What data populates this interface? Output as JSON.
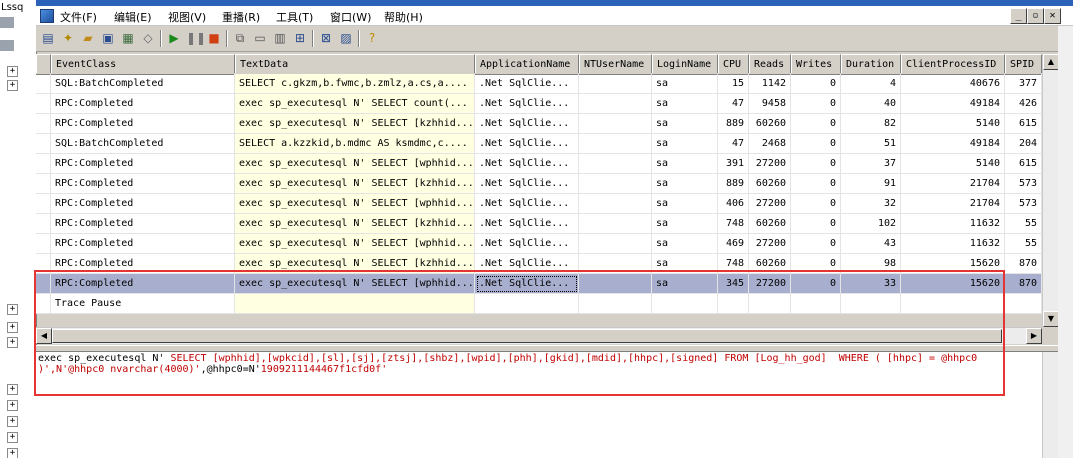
{
  "sidebar": {
    "top_label": "Lssq"
  },
  "menu": {
    "items": [
      "文件(F)",
      "编辑(E)",
      "视图(V)",
      "重播(R)",
      "工具(T)",
      "窗口(W)",
      "帮助(H)"
    ]
  },
  "window_controls": {
    "minimize": "_",
    "restore": "▫",
    "close": "✕"
  },
  "toolbar": {
    "icons": [
      "properties-icon",
      "new-trace-icon",
      "open-icon",
      "save-icon",
      "template-icon",
      "eraser-icon",
      "run-icon",
      "pause-icon",
      "stop-icon",
      "cascade-icon",
      "tile-icon",
      "events-icon",
      "filter-icon",
      "find-icon",
      "chart-icon",
      "help-icon"
    ]
  },
  "grid": {
    "columns": [
      "EventClass",
      "TextData",
      "ApplicationName",
      "NTUserName",
      "LoginName",
      "CPU",
      "Reads",
      "Writes",
      "Duration",
      "ClientProcessID",
      "SPID"
    ],
    "rows": [
      [
        "SQL:BatchCompleted",
        "SELECT c.gkzm,b.fwmc,b.zmlz,a.cs,a....",
        ".Net SqlClie...",
        "",
        "sa",
        "15",
        "1142",
        "0",
        "4",
        "40676",
        "377"
      ],
      [
        "RPC:Completed",
        "exec sp_executesql N' SELECT count(...",
        ".Net SqlClie...",
        "",
        "sa",
        "47",
        "9458",
        "0",
        "40",
        "49184",
        "426"
      ],
      [
        "RPC:Completed",
        "exec sp_executesql N' SELECT [kzhhid...",
        ".Net SqlClie...",
        "",
        "sa",
        "889",
        "60260",
        "0",
        "82",
        "5140",
        "615"
      ],
      [
        "SQL:BatchCompleted",
        "SELECT a.kzzkid,b.mdmc AS ksmdmc,c....",
        ".Net SqlClie...",
        "",
        "sa",
        "47",
        "2468",
        "0",
        "51",
        "49184",
        "204"
      ],
      [
        "RPC:Completed",
        "exec sp_executesql N' SELECT [wphhid...",
        ".Net SqlClie...",
        "",
        "sa",
        "391",
        "27200",
        "0",
        "37",
        "5140",
        "615"
      ],
      [
        "RPC:Completed",
        "exec sp_executesql N' SELECT [kzhhid...",
        ".Net SqlClie...",
        "",
        "sa",
        "889",
        "60260",
        "0",
        "91",
        "21704",
        "573"
      ],
      [
        "RPC:Completed",
        "exec sp_executesql N' SELECT [wphhid...",
        ".Net SqlClie...",
        "",
        "sa",
        "406",
        "27200",
        "0",
        "32",
        "21704",
        "573"
      ],
      [
        "RPC:Completed",
        "exec sp_executesql N' SELECT [kzhhid...",
        ".Net SqlClie...",
        "",
        "sa",
        "748",
        "60260",
        "0",
        "102",
        "11632",
        "55"
      ],
      [
        "RPC:Completed",
        "exec sp_executesql N' SELECT [wphhid...",
        ".Net SqlClie...",
        "",
        "sa",
        "469",
        "27200",
        "0",
        "43",
        "11632",
        "55"
      ],
      [
        "RPC:Completed",
        "exec sp_executesql N' SELECT [kzhhid...",
        ".Net SqlClie...",
        "",
        "sa",
        "748",
        "60260",
        "0",
        "98",
        "15620",
        "870"
      ],
      [
        "RPC:Completed",
        "exec sp_executesql N' SELECT [wphhid...",
        ".Net SqlClie...",
        "",
        "sa",
        "345",
        "27200",
        "0",
        "33",
        "15620",
        "870"
      ],
      [
        "Trace Pause",
        "",
        "",
        "",
        "",
        "",
        "",
        "",
        "",
        "",
        ""
      ]
    ],
    "selected_row": 10
  },
  "detail": {
    "line1_a": "exec sp_executesql N'",
    "line1_b": " SELECT [wphhid],[wpkcid],[sl],[sj],[ztsj],[shbz],[wpid],[phh],[gkid],[mdid],[hhpc],[signed] FROM [Log_hh_god]  WHERE ( [hhpc] = @hhpc0",
    "line2_a": ")',N'",
    "line2_b": "@hhpc0 nvarchar(4000)'",
    "line2_c": ",@hhpc0=N'",
    "line2_d": "1909211144467f1cfd0f'"
  },
  "colors": {
    "selected_row": "#a8aecd",
    "textdata_bg": "#ffffe1",
    "highlight": "#e53434"
  }
}
